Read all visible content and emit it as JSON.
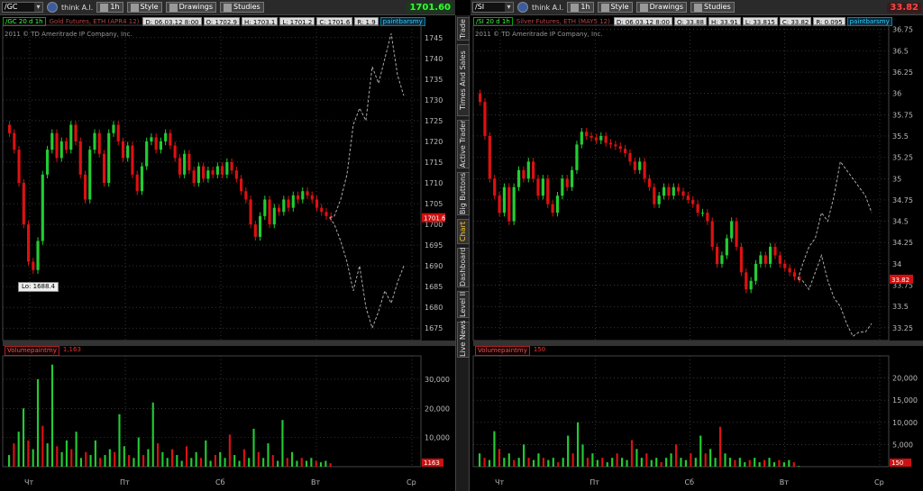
{
  "left": {
    "toolbar": {
      "symbol": "/GC",
      "think": "think A.l.",
      "timeframe": "1h",
      "style": "Style",
      "drawings": "Drawings",
      "studies": "Studies",
      "price": "1701.60"
    },
    "header": {
      "symbol": "/GC 20 d 1h",
      "title": "Gold Futures, ETH (APR4 12)",
      "fields": [
        "D: 06.03.12 8:00",
        "O: 1702.9",
        "H: 1703.1",
        "L: 1701.2",
        "C: 1701.6",
        "R: 1.9"
      ],
      "study": "paintbarsmy"
    },
    "copyright": "2011 © TD Ameritrade IP Company, Inc.",
    "lo_label": "Lo: 1688.4",
    "current_price_tag": "1701.6",
    "volume_study": "Volumepaintmy",
    "volume_value": "1,163",
    "volume_tag": "1163"
  },
  "right": {
    "toolbar": {
      "symbol": "/SI",
      "think": "think A.l.",
      "timeframe": "1h",
      "style": "Style",
      "drawings": "Drawings",
      "studies": "Studies",
      "price": "33.82"
    },
    "header": {
      "symbol": "/SI 20 d 1h",
      "title": "Silver Futures, ETH (MAY5 12)",
      "fields": [
        "D: 06.03.12 8:00",
        "O: 33.88",
        "H: 33.91",
        "L: 33.815",
        "C: 33.82",
        "R: 0.095"
      ],
      "study": "paintbarsmy"
    },
    "copyright": "2011 © TD Ameritrade IP Company, Inc.",
    "current_price_tag": "33.82",
    "volume_study": "Volumepaintmy",
    "volume_value": "150",
    "volume_tag": "150"
  },
  "tabs": [
    "Trade",
    "Times And Sales",
    "Active Trader",
    "Big Buttons",
    "Chart",
    "Dashboard",
    "Level II",
    "Live News"
  ],
  "active_tab": "Chart",
  "colors": {
    "up": "#22cc33",
    "down": "#dd1111",
    "projection": "#aaaaaa",
    "grid": "#555555",
    "axis_text": "#bbbbbb"
  },
  "chart_data": [
    {
      "type": "candlestick",
      "title": "Gold Futures, ETH (APR4 12)",
      "ylim": [
        1672,
        1748
      ],
      "yticks": [
        1675,
        1680,
        1685,
        1690,
        1695,
        1700,
        1705,
        1710,
        1715,
        1720,
        1725,
        1730,
        1735,
        1740,
        1745
      ],
      "xticks": [
        "Чт",
        "Пт",
        "Сб",
        "Вт",
        "Ср"
      ],
      "closes": [
        1722,
        1718,
        1710,
        1700,
        1691,
        1689,
        1696,
        1712,
        1718,
        1722,
        1716,
        1720,
        1718,
        1724,
        1720,
        1712,
        1706,
        1718,
        1722,
        1717,
        1710,
        1722,
        1724,
        1720,
        1716,
        1719,
        1712,
        1708,
        1714,
        1720,
        1721,
        1718,
        1720,
        1722,
        1719,
        1716,
        1712,
        1717,
        1713,
        1710,
        1714,
        1711,
        1713,
        1712,
        1714,
        1712,
        1715,
        1713,
        1711,
        1708,
        1706,
        1700,
        1697,
        1702,
        1706,
        1700,
        1704,
        1703,
        1706,
        1704,
        1707,
        1706,
        1708,
        1707,
        1706,
        1704,
        1703,
        1702,
        1701.6
      ],
      "projection_upper": [
        1702,
        1706,
        1712,
        1724,
        1728,
        1725,
        1738,
        1734,
        1740,
        1746,
        1736,
        1731
      ],
      "projection_lower": [
        1700,
        1696,
        1691,
        1684,
        1690,
        1680,
        1675,
        1679,
        1684,
        1681,
        1686,
        1690
      ],
      "volume": {
        "ylim": [
          0,
          38000
        ],
        "yticks": [
          "10,000",
          "20,000",
          "30,000"
        ],
        "values": [
          4000,
          8000,
          12000,
          20000,
          9000,
          6000,
          30000,
          14000,
          8000,
          35000,
          7000,
          5000,
          9000,
          6000,
          12000,
          3000,
          5000,
          4000,
          9000,
          3000,
          4000,
          6000,
          5000,
          18000,
          7000,
          4000,
          3000,
          10000,
          4000,
          6000,
          22000,
          8000,
          5000,
          3000,
          6000,
          4000,
          2000,
          7000,
          3000,
          5000,
          3000,
          9000,
          2000,
          4000,
          5000,
          3000,
          11000,
          4000,
          2000,
          6000,
          3000,
          13000,
          5000,
          3000,
          8000,
          4000,
          2000,
          16000,
          3000,
          5000,
          2000,
          3000,
          2000,
          3000,
          2000,
          1500,
          2000,
          1163
        ]
      }
    },
    {
      "type": "candlestick",
      "title": "Silver Futures, ETH (MAY5 12)",
      "ylim": [
        33.1,
        36.8
      ],
      "yticks": [
        33.25,
        33.5,
        33.75,
        34,
        34.25,
        34.5,
        34.75,
        35,
        35.25,
        35.5,
        35.75,
        36,
        36.25,
        36.5,
        36.75
      ],
      "xticks": [
        "Чт",
        "Пт",
        "Сб",
        "Вт",
        "Ср"
      ],
      "closes": [
        35.9,
        35.5,
        35.0,
        34.8,
        34.6,
        34.9,
        34.5,
        34.9,
        35.1,
        35.0,
        35.2,
        35.0,
        34.8,
        35.0,
        34.7,
        34.6,
        34.8,
        35.0,
        34.9,
        35.1,
        35.4,
        35.55,
        35.5,
        35.48,
        35.45,
        35.5,
        35.42,
        35.4,
        35.38,
        35.35,
        35.3,
        35.2,
        35.1,
        35.2,
        35.0,
        34.9,
        34.7,
        34.8,
        34.9,
        34.8,
        34.9,
        34.85,
        34.8,
        34.75,
        34.7,
        34.6,
        34.6,
        34.5,
        34.2,
        34.0,
        34.1,
        34.3,
        34.5,
        34.2,
        33.9,
        33.7,
        33.8,
        34.0,
        34.1,
        34.0,
        34.2,
        34.1,
        34.0,
        33.95,
        33.9,
        33.85,
        33.82
      ],
      "projection_upper": [
        34.0,
        34.2,
        34.3,
        34.6,
        34.5,
        34.8,
        35.2,
        35.1,
        35.0,
        34.9,
        34.8,
        34.6
      ],
      "projection_lower": [
        33.8,
        33.7,
        33.9,
        34.1,
        33.8,
        33.6,
        33.5,
        33.3,
        33.15,
        33.2,
        33.2,
        33.3
      ],
      "volume": {
        "ylim": [
          0,
          25000
        ],
        "yticks": [
          "5,000",
          "10,000",
          "15,000",
          "20,000"
        ],
        "values": [
          3000,
          2000,
          1500,
          8000,
          4000,
          2000,
          3000,
          1500,
          2000,
          5000,
          2000,
          1500,
          3000,
          2000,
          1500,
          2000,
          1000,
          2000,
          7000,
          3000,
          10000,
          5000,
          2000,
          3000,
          1500,
          2000,
          1000,
          2000,
          3000,
          2000,
          1500,
          6000,
          4000,
          2000,
          3000,
          1500,
          2000,
          1000,
          2000,
          3000,
          5000,
          2000,
          1500,
          3000,
          2000,
          7000,
          3000,
          4000,
          2000,
          9000,
          3000,
          2000,
          1500,
          2000,
          1000,
          1500,
          2000,
          1000,
          1500,
          2000,
          1000,
          1500,
          1000,
          1500,
          1000,
          150
        ]
      }
    }
  ]
}
